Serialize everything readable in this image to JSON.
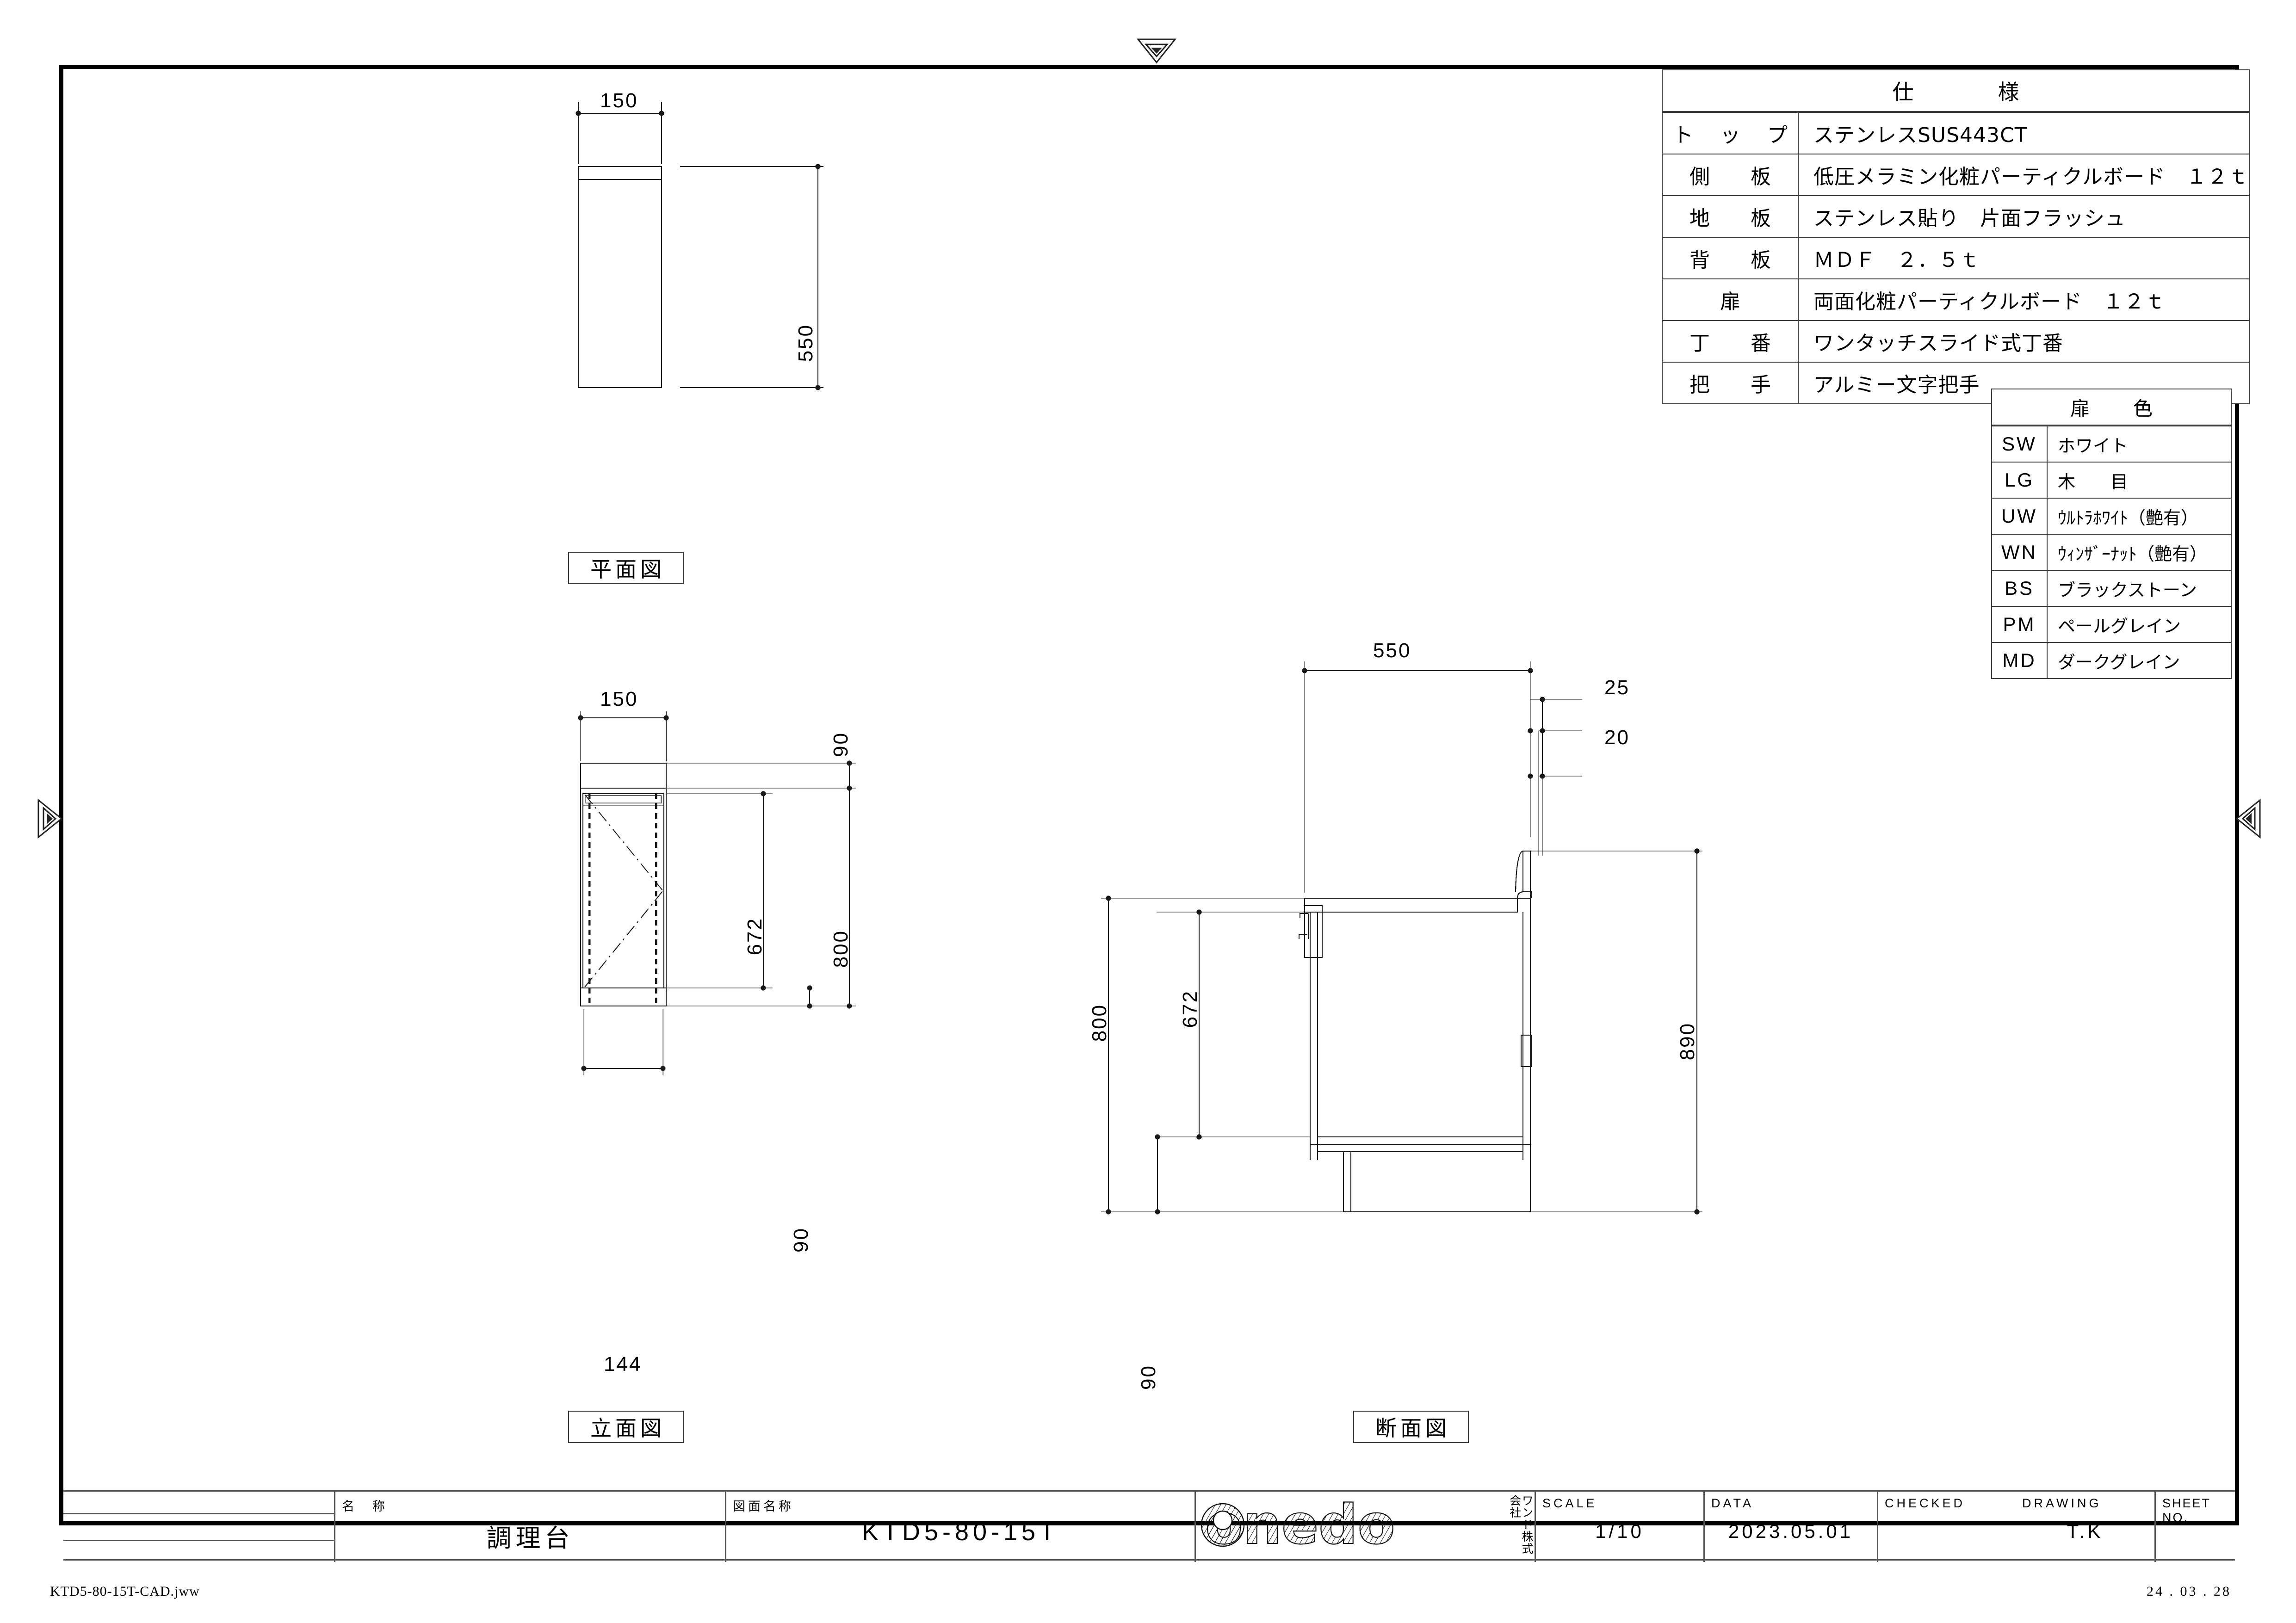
{
  "sheet": {
    "filename": "KTD5-80-15T-CAD.jww",
    "revision_date": "24 . 03 . 28"
  },
  "spec_table": {
    "header": "仕　　様",
    "rows": [
      {
        "key": "ト ッ プ",
        "value": "ステンレスSUS443CT"
      },
      {
        "key": "側　板",
        "value": "低圧メラミン化粧パーティクルボード　１２ｔ"
      },
      {
        "key": "地　板",
        "value": "ステンレス貼り　片面フラッシュ"
      },
      {
        "key": "背　板",
        "value": "ＭＤＦ　２．５ｔ"
      },
      {
        "key": "扉",
        "value": "両面化粧パーティクルボード　１２ｔ"
      },
      {
        "key": "丁　番",
        "value": "ワンタッチスライド式丁番"
      },
      {
        "key": "把　手",
        "value": "アルミー文字把手"
      }
    ]
  },
  "color_table": {
    "header": "扉　色",
    "rows": [
      {
        "code": "SW",
        "name": "ホワイト"
      },
      {
        "code": "LG",
        "name": "木　　目"
      },
      {
        "code": "UW",
        "name": "ｳﾙﾄﾗﾎﾜｲﾄ（艶有）"
      },
      {
        "code": "WN",
        "name": "ｳｨﾝｻﾞｰﾅｯﾄ（艶有）"
      },
      {
        "code": "BS",
        "name": "ブラックストーン"
      },
      {
        "code": "PM",
        "name": "ペールグレイン"
      },
      {
        "code": "MD",
        "name": "ダークグレイン"
      }
    ]
  },
  "views": {
    "plan": {
      "label": "平面図",
      "dims": {
        "width": "150",
        "depth": "550"
      }
    },
    "elevation": {
      "label": "立面図",
      "dims": {
        "width": "150",
        "door_width": "144",
        "top_gap": "90",
        "door_height": "672",
        "bottom_gap": "90",
        "body_height": "800"
      }
    },
    "section": {
      "label": "断面図",
      "dims": {
        "depth": "550",
        "backsplash": "25",
        "top_thickness": "20",
        "body_height": "800",
        "door_height": "672",
        "toe_kick": "90",
        "overall_height": "890"
      }
    }
  },
  "title_block": {
    "name_label": "名　称",
    "name_value": "調理台",
    "drawing_name_label": "図面名称",
    "drawing_name_value": "KTD5-80-15T",
    "company_logo": "onedo",
    "company_name": "ワンド株式会社",
    "scale_label": "SCALE",
    "scale_value": "1/10",
    "data_label": "DATA",
    "data_value": "2023.05.01",
    "checked_label": "CHECKED",
    "checked_value": "",
    "drawing_label": "DRAWING",
    "drawing_value": "T.K",
    "sheet_no_label": "SHEET NO.",
    "sheet_no_value": ""
  }
}
